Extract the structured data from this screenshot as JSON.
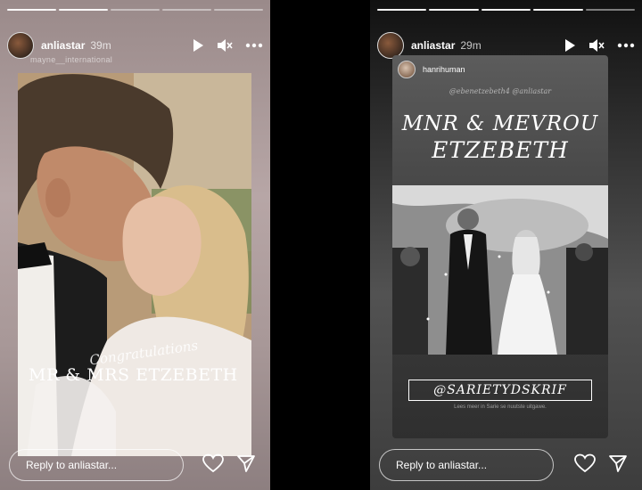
{
  "left_story": {
    "username": "anliastar",
    "time": "39m",
    "mention": "mayne__international",
    "overlay_script": "Congratulations",
    "overlay_title": "MR & MRS ETZEBETH",
    "reply_placeholder": "Reply to anliastar..."
  },
  "right_story": {
    "username": "anliastar",
    "time": "29m",
    "shared_user": "hanrihuman",
    "shared_caption": "@ebenetzebeth4 @anliastar",
    "title_line1": "MNR & MEVROU",
    "title_line2": "ETZEBETH",
    "tag": "@SARIETYDSKRIF",
    "tag_sub": "Lees meer in Sarie se nuutste uitgawe.",
    "reply_placeholder": "Reply to anliastar..."
  },
  "icons": {
    "play": "play-icon",
    "mute": "mute-icon",
    "more": "more-icon",
    "heart": "heart-icon",
    "send": "send-icon"
  }
}
